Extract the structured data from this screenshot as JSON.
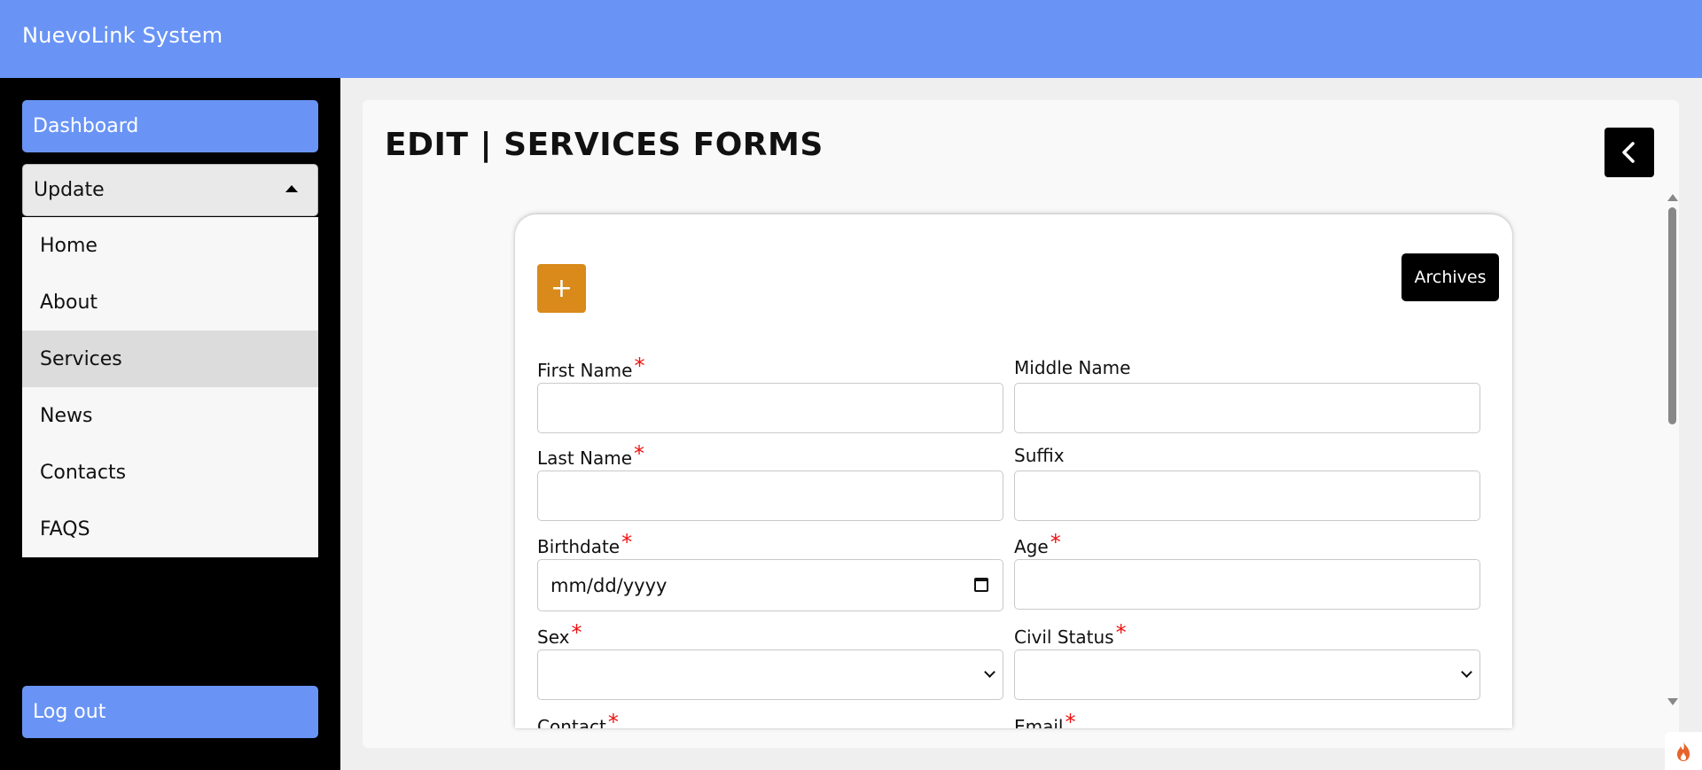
{
  "header": {
    "brand": "NuevoLink System"
  },
  "sidebar": {
    "dashboard_label": "Dashboard",
    "update_label": "Update",
    "menu": [
      {
        "label": "Home"
      },
      {
        "label": "About"
      },
      {
        "label": "Services",
        "active": true
      },
      {
        "label": "News"
      },
      {
        "label": "Contacts"
      },
      {
        "label": "FAQS"
      }
    ],
    "logout_label": "Log out"
  },
  "page": {
    "title": "EDIT | SERVICES FORMS"
  },
  "form": {
    "add_label": "+",
    "archives_label": "Archives",
    "fields": {
      "first_name": {
        "label": "First Name",
        "required_mark": "*",
        "value": ""
      },
      "middle_name": {
        "label": "Middle Name",
        "value": ""
      },
      "last_name": {
        "label": "Last Name",
        "required_mark": "*",
        "value": ""
      },
      "suffix": {
        "label": "Suffix",
        "value": ""
      },
      "birthdate": {
        "label": "Birthdate",
        "required_mark": "*",
        "placeholder": "mm/dd/yyyy"
      },
      "age": {
        "label": "Age",
        "required_mark": "*",
        "value": ""
      },
      "sex": {
        "label": "Sex",
        "required_mark": "*",
        "value": ""
      },
      "civil_status": {
        "label": "Civil Status",
        "required_mark": "*",
        "value": ""
      },
      "contact": {
        "label": "Contact",
        "required_mark": "*"
      },
      "email": {
        "label": "Email",
        "required_mark": "*"
      }
    }
  },
  "icons": {
    "back": "chevron-left-icon",
    "calendar": "calendar-icon",
    "select": "chevron-down-icon",
    "corner": "flame-icon"
  },
  "colors": {
    "primary": "#6994f5",
    "sidebar_bg": "#000000",
    "add_button": "#d98a1b",
    "required": "#ee1111"
  }
}
